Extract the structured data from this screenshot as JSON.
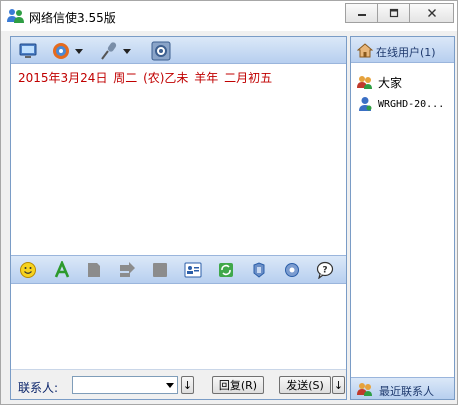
{
  "window": {
    "title": "网络信使3.55版",
    "minimize_icon": "minimize-icon",
    "maximize_icon": "maximize-icon",
    "close_icon": "close-icon"
  },
  "toolbar": {
    "items": [
      {
        "icon": "monitor-icon",
        "has_dropdown": false
      },
      {
        "icon": "emotion-globe-icon",
        "has_dropdown": true
      },
      {
        "icon": "microphone-icon",
        "has_dropdown": true
      },
      {
        "icon": "settings-icon",
        "has_dropdown": false
      }
    ]
  },
  "message_area": {
    "date_line": "2015年3月24日 周二   (农)乙未 羊年 二月初五",
    "date_color": "#c00000"
  },
  "format_toolbar": {
    "icons": [
      "smiley-icon",
      "font-icon",
      "page-icon",
      "forward-icon",
      "square-icon",
      "contact-card-icon",
      "refresh-icon",
      "plugin-icon",
      "gear-icon",
      "help-icon"
    ]
  },
  "bottom_bar": {
    "contact_label": "联系人:",
    "contact_value": "",
    "down_arrow": "↓",
    "reply_label": "回复(R)",
    "send_label": "发送(S)",
    "send_arrow": "↓"
  },
  "right_panel": {
    "header": "在线用户(1)",
    "users": [
      {
        "name": "大家",
        "icon": "group-users-icon"
      },
      {
        "name": "WRGHD-20...",
        "icon": "user-icon"
      }
    ],
    "footer": "最近联系人"
  },
  "colors": {
    "accent": "#7a9cc6",
    "toolbar_top": "#dbe8f8",
    "toolbar_bottom": "#b7cfef"
  }
}
